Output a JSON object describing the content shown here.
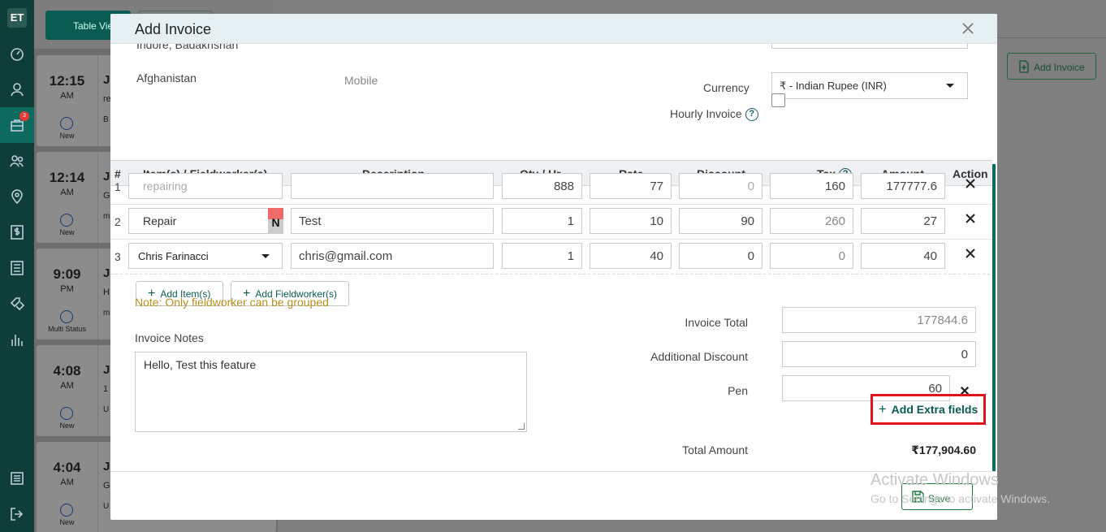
{
  "sidebar": {
    "logo": "ET",
    "badge_count": "3"
  },
  "background": {
    "table_view_label": "Table Vie",
    "add_invoice_label": "Add Invoice",
    "cards": [
      {
        "time": "12:15",
        "ampm": "AM",
        "status": "New",
        "title": "Ji",
        "line2": "re",
        "line3": "B"
      },
      {
        "time": "12:14",
        "ampm": "AM",
        "status": "New",
        "title": "Ji",
        "line2": "G",
        "line3": "m"
      },
      {
        "time": "9:09",
        "ampm": "PM",
        "status": "Multi Status",
        "title": "Ji",
        "line2": "H",
        "line3": "m"
      },
      {
        "time": "4:08",
        "ampm": "AM",
        "status": "New",
        "title": "Ji",
        "line2": "1",
        "line3": "U"
      },
      {
        "time": "4:04",
        "ampm": "AM",
        "status": "New",
        "title": "Ji",
        "line2": "G",
        "line3": "U"
      }
    ]
  },
  "modal": {
    "title": "Add Invoice",
    "address_line1": "Indore, Badakhshan",
    "address_line2": "Afghanistan",
    "mobile_label": "Mobile",
    "currency_label": "Currency",
    "currency_value": "₹ - Indian Rupee (INR)",
    "hourly_label": "Hourly Invoice",
    "hourly_checked": false,
    "table": {
      "headers": {
        "num": "#",
        "item": "Item(s) / Fieldworker(s)",
        "desc": "Description",
        "qty": "Qty / Hr",
        "rate": "Rate",
        "discount": "Discount",
        "tax": "Tax",
        "amount": "Amount",
        "action": "Action"
      },
      "rows": [
        {
          "num": "1",
          "item": "repairing",
          "desc": "",
          "qty": "888",
          "rate": "77",
          "discount": "0",
          "tax": "160",
          "amount": "177777.6"
        },
        {
          "num": "2",
          "item": "Repair",
          "badge": "N",
          "desc": "Test",
          "qty": "1",
          "rate": "10",
          "discount": "90",
          "tax": "260",
          "amount": "27"
        },
        {
          "num": "3",
          "item": "Chris Farinacci",
          "desc": "chris@gmail.com",
          "qty": "1",
          "rate": "40",
          "discount": "0",
          "tax": "0",
          "amount": "40"
        }
      ]
    },
    "add_item_label": "Add Item(s)",
    "add_fieldworker_label": "Add Fieldworker(s)",
    "note": "Note: Only fieldworker can be grouped",
    "notes_label": "Invoice Notes",
    "notes_value": "Hello, Test this feature",
    "summary": {
      "invoice_total_label": "Invoice Total",
      "invoice_total_value": "177844.6",
      "additional_discount_label": "Additional Discount",
      "additional_discount_value": "0",
      "pen_label": "Pen",
      "pen_value": "60",
      "add_extra_label": "Add Extra fields",
      "total_amount_label": "Total Amount",
      "total_amount_value": "₹177,904.60"
    },
    "save_label": "Save"
  },
  "watermark": {
    "line1": "Activate Windows",
    "line2": "Go to Settings to activate Windows."
  },
  "colors": {
    "sidebar": "#0f3d37",
    "accent": "#0a5b52",
    "highlight": "#e0141c",
    "note": "#b8901c"
  }
}
